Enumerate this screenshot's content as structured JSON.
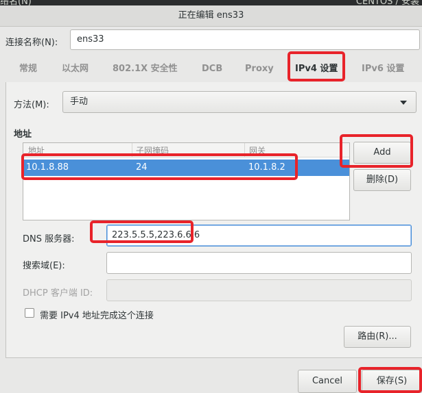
{
  "background_window": {
    "left_text": "络名(N)",
    "right_text": "CENTOS / 安装"
  },
  "dialog": {
    "title": "正在编辑 ens33"
  },
  "connection": {
    "label": "连接名称(N):",
    "value": "ens33"
  },
  "tabs": [
    {
      "label": "常规"
    },
    {
      "label": "以太网"
    },
    {
      "label": "802.1X 安全性"
    },
    {
      "label": "DCB"
    },
    {
      "label": "Proxy"
    },
    {
      "label": "IPv4 设置",
      "active": true
    },
    {
      "label": "IPv6 设置"
    }
  ],
  "ipv4": {
    "method_label": "方法(M):",
    "method_value": "手动",
    "address_title": "地址",
    "address_columns": [
      "地址",
      "子网掩码",
      "网关"
    ],
    "address_rows": [
      {
        "address": "10.1.8.88",
        "netmask": "24",
        "gateway": "10.1.8.2"
      }
    ],
    "add_label": "Add",
    "delete_label": "删除(D)",
    "dns_label": "DNS 服务器:",
    "dns_value": "223.5.5.5,223.6.6.6",
    "search_label": "搜索域(E):",
    "search_value": "",
    "dhcp_label": "DHCP 客户端 ID:",
    "dhcp_value": "",
    "require_label": "需要 IPv4 地址完成这个连接",
    "route_label": "路由(R)..."
  },
  "footer": {
    "cancel_label": "Cancel",
    "save_label": "保存(S)"
  },
  "colors": {
    "accent": "#4a90d9",
    "highlight": "#e8232a"
  }
}
